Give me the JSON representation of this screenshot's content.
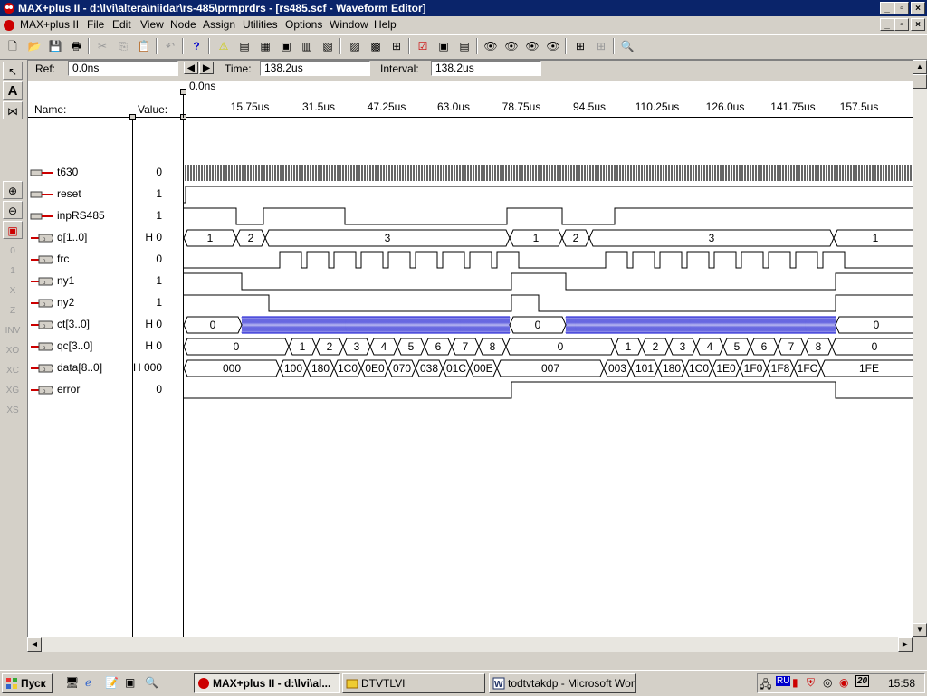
{
  "window": {
    "title": "MAX+plus II - d:\\lvi\\altera\\niidar\\rs-485\\prmprdrs - [rs485.scf - Waveform Editor]"
  },
  "menu": [
    "MAX+plus II",
    "File",
    "Edit",
    "View",
    "Node",
    "Assign",
    "Utilities",
    "Options",
    "Window",
    "Help"
  ],
  "editor": {
    "ref_label": "Ref:",
    "ref_value": "0.0ns",
    "time_label": "Time:",
    "time_value": "138.2us",
    "interval_label": "Interval:",
    "interval_value": "138.2us",
    "name_header": "Name:",
    "value_header": "Value:",
    "start_time": "0.0ns",
    "ticks": [
      "15.75us",
      "31.5us",
      "47.25us",
      "63.0us",
      "78.75us",
      "94.5us",
      "110.25us",
      "126.0us",
      "141.75us",
      "157.5us"
    ]
  },
  "signals": [
    {
      "name": "t630",
      "value": "0",
      "type": "input"
    },
    {
      "name": "reset",
      "value": "1",
      "type": "input"
    },
    {
      "name": "inpRS485",
      "value": "1",
      "type": "input"
    },
    {
      "name": "q[1..0]",
      "value": "H 0",
      "type": "output",
      "bus_values": [
        "1",
        "2",
        "3",
        "1",
        "2",
        "3",
        "1"
      ]
    },
    {
      "name": "frc",
      "value": "0",
      "type": "output"
    },
    {
      "name": "ny1",
      "value": "1",
      "type": "output"
    },
    {
      "name": "ny2",
      "value": "1",
      "type": "output"
    },
    {
      "name": "ct[3..0]",
      "value": "H 0",
      "type": "output",
      "bus_values": [
        "0",
        "0",
        "0"
      ]
    },
    {
      "name": "qc[3..0]",
      "value": "H 0",
      "type": "output",
      "bus_values": [
        "0",
        "1",
        "2",
        "3",
        "4",
        "5",
        "6",
        "7",
        "8",
        "0",
        "1",
        "2",
        "3",
        "4",
        "5",
        "6",
        "7",
        "8",
        "0"
      ]
    },
    {
      "name": "data[8..0]",
      "value": "H 000",
      "type": "output",
      "bus_values": [
        "000",
        "100",
        "180",
        "1C0",
        "0E0",
        "070",
        "038",
        "01C",
        "00E",
        "007",
        "003",
        "101",
        "180",
        "1C0",
        "1E0",
        "1F0",
        "1F8",
        "1FC",
        "1FE"
      ]
    },
    {
      "name": "error",
      "value": "0",
      "type": "output"
    }
  ],
  "taskbar": {
    "start": "Пуск",
    "tasks": [
      "MAX+plus II - d:\\lvi\\al...",
      "DTVTLVI",
      "todtvtakdp - Microsoft Word"
    ],
    "clock": "15:58",
    "lang": "RU",
    "date_badge": "20"
  }
}
